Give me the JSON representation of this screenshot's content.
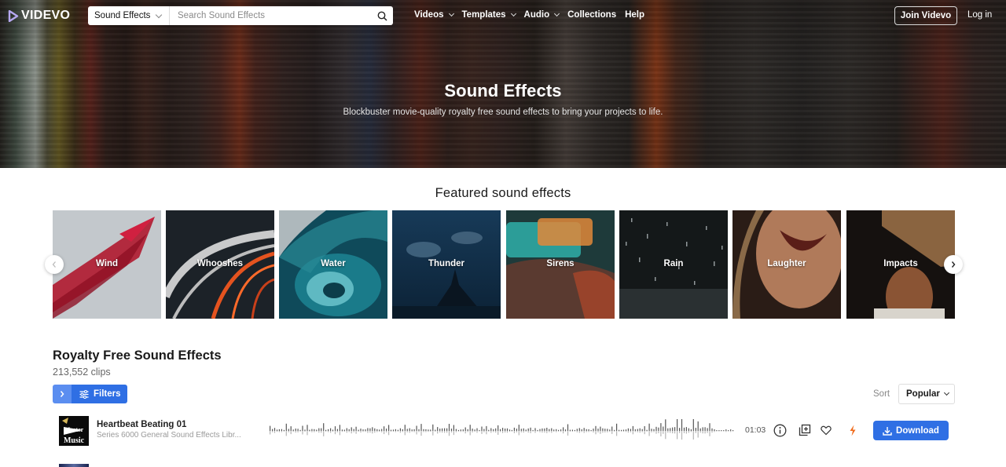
{
  "nav": {
    "logo_text": "VIDEVO",
    "search_category": "Sound Effects",
    "search_placeholder": "Search Sound Effects",
    "search_value": "",
    "links": [
      {
        "label": "Videos",
        "has_dropdown": true
      },
      {
        "label": "Templates",
        "has_dropdown": true
      },
      {
        "label": "Audio",
        "has_dropdown": true
      },
      {
        "label": "Collections",
        "has_dropdown": false
      },
      {
        "label": "Help",
        "has_dropdown": false
      }
    ],
    "join_label": "Join Videvo",
    "login_label": "Log in"
  },
  "hero": {
    "title": "Sound Effects",
    "subtitle": "Blockbuster movie-quality royalty free sound effects to bring your projects to life."
  },
  "featured": {
    "title": "Featured sound effects",
    "categories": [
      {
        "label": "Wind"
      },
      {
        "label": "Whooshes"
      },
      {
        "label": "Water"
      },
      {
        "label": "Thunder"
      },
      {
        "label": "Sirens"
      },
      {
        "label": "Rain"
      },
      {
        "label": "Laughter"
      },
      {
        "label": "Impacts"
      }
    ]
  },
  "listing": {
    "title": "Royalty Free Sound Effects",
    "count": "213,552 clips",
    "filters_label": "Filters",
    "sort_label": "Sort",
    "sort_value": "Popular",
    "tracks": [
      {
        "title": "Heartbeat Beating 01",
        "subtitle": "Series 6000 General Sound Effects Libr...",
        "thumb_text": "Master Music",
        "duration": "01:03",
        "download_label": "Download",
        "accent_color": "#f06a1a"
      }
    ]
  },
  "colors": {
    "primary": "#2f6fe4",
    "primary_light": "#5b8ef0",
    "accent": "#f06a1a"
  }
}
